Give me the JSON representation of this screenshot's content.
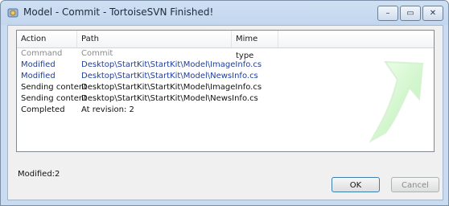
{
  "window": {
    "title": "Model - Commit - TortoiseSVN Finished!"
  },
  "caption_buttons": {
    "minimize": "–",
    "maximize": "▭",
    "close": "✕"
  },
  "list": {
    "columns": [
      "Action",
      "Path",
      "Mime type"
    ],
    "rows": [
      {
        "action": "Command",
        "path": "Commit",
        "color": "#8a8a8a"
      },
      {
        "action": "Modified",
        "path": "Desktop\\StartKit\\StartKit\\Model\\ImageInfo.cs",
        "color": "#1f3e9a"
      },
      {
        "action": "Modified",
        "path": "Desktop\\StartKit\\StartKit\\Model\\NewsInfo.cs",
        "color": "#1f3e9a"
      },
      {
        "action": "Sending content",
        "path": "Desktop\\StartKit\\StartKit\\Model\\ImageInfo.cs",
        "color": "#111111"
      },
      {
        "action": "Sending content",
        "path": "Desktop\\StartKit\\StartKit\\Model\\NewsInfo.cs",
        "color": "#111111"
      },
      {
        "action": "Completed",
        "path": "At revision: 2",
        "color": "#111111"
      }
    ]
  },
  "status": {
    "text": "Modified:2"
  },
  "buttons": {
    "ok": "OK",
    "cancel": "Cancel"
  }
}
